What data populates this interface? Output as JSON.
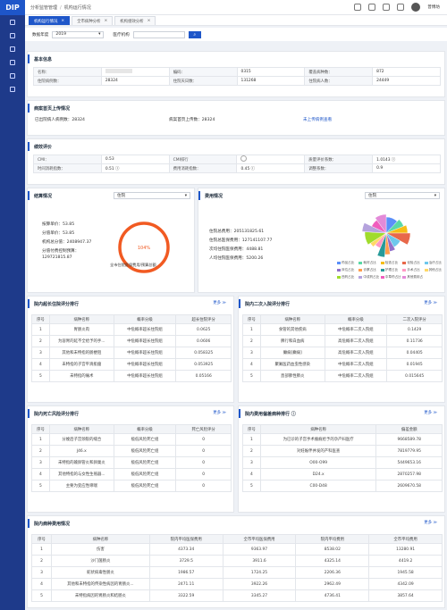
{
  "header": {
    "logo": "DIP",
    "crumbs": [
      "分析监管管理",
      "机构运行情况"
    ],
    "username": "普博坊"
  },
  "tabs": [
    {
      "label": "机构运行情况",
      "active": true
    },
    {
      "label": "全市病种分析",
      "active": false
    },
    {
      "label": "机构绩效分析",
      "active": false
    }
  ],
  "filter": {
    "year_label": "数据年度",
    "year_value": "2019",
    "org_label": "医疗机构",
    "search_icon": "search-icon"
  },
  "basic": {
    "title": "基本信息",
    "rows": [
      [
        "名称：",
        "",
        "编码：",
        "0315",
        "覆盖病种数：",
        "872"
      ],
      [
        "住院病例数：",
        "28324",
        "住院天日数：",
        "131268",
        "住院病人数：",
        "24449"
      ]
    ]
  },
  "upload": {
    "title": "病案首页上传情况",
    "items": [
      "已出院病人病例数：28324",
      "病案首页上传数：28324"
    ],
    "link": "未上传病例查看"
  },
  "perf": {
    "title": "绩效评价",
    "rows": [
      [
        "CMI：",
        "0.53",
        "CMI排行",
        "",
        "质量评价系数：",
        "1.0143"
      ],
      [
        "时间消耗指数：",
        "0.51",
        "费用消耗指数：",
        "0.45",
        "调整系数：",
        "0.9"
      ]
    ]
  },
  "settle": {
    "title": "结算情况",
    "select": "住院",
    "lines": [
      "按算单价：53.85",
      "分值单价：53.85",
      "机构总分值：2408947.37",
      "分值付费控制预算：",
      "129721815.87"
    ],
    "gauge_label": "104%",
    "gauge_value": 1.04,
    "gauge_caption": "全市住院医保费用/预算总额"
  },
  "cost": {
    "title": "费用情况",
    "select": "住院",
    "lines": [
      "住院总费用：205131825.61",
      "住院总医保费用：127141107.77",
      "次均住院医保费用：4488.81",
      "人均住院医保费用：5200.26"
    ],
    "legend": [
      {
        "name": "药品占比",
        "color": "#5b8ff9"
      },
      {
        "name": "耗材占比",
        "color": "#5ad8a6"
      },
      {
        "name": "检查占比",
        "color": "#f6bd16"
      },
      {
        "name": "化验占比",
        "color": "#e8684a"
      },
      {
        "name": "治疗占比",
        "color": "#6dc8ec"
      },
      {
        "name": "床位占比",
        "color": "#9270ca"
      },
      {
        "name": "诊察占比",
        "color": "#ff9d4d"
      },
      {
        "name": "护理占比",
        "color": "#269a99"
      },
      {
        "name": "手术占比",
        "color": "#ff99c3"
      },
      {
        "name": "其他占比",
        "color": "#ffd866"
      },
      {
        "name": "西药占比",
        "color": "#a0dc2c"
      },
      {
        "name": "中成药占比",
        "color": "#b5a3dd"
      },
      {
        "name": "中草药占比",
        "color": "#f05dbd"
      },
      {
        "name": "其他费用占比",
        "color": "#e38ad8"
      }
    ]
  },
  "chart_data": {
    "type": "pie",
    "labels": [
      "药品占比",
      "耗材占比",
      "检查占比",
      "化验占比",
      "治疗占比",
      "床位占比",
      "诊察占比",
      "护理占比",
      "手术占比",
      "其他占比",
      "西药占比",
      "中成药占比",
      "中草药占比",
      "其他费用占比"
    ],
    "values": [
      12,
      7,
      6,
      8,
      9,
      5,
      4,
      5,
      6,
      4,
      10,
      6,
      8,
      10
    ],
    "colors": [
      "#5b8ff9",
      "#5ad8a6",
      "#f6bd16",
      "#e8684a",
      "#6dc8ec",
      "#9270ca",
      "#ff9d4d",
      "#269a99",
      "#ff99c3",
      "#ffd866",
      "#a0dc2c",
      "#b5a3dd",
      "#f05dbd",
      "#e38ad8"
    ]
  },
  "more_label": "更多 ≫",
  "t1": {
    "title": "院内超长住院评分排行",
    "headers": [
      "序号",
      "病种名称",
      "概率分级",
      "超长住院评分"
    ],
    "rows": [
      [
        "1",
        "胃肠炎肉",
        "中危概率超长住院组",
        "0.0625"
      ],
      [
        "2",
        "为容胃的延不全给予的手...",
        "中危概率超长住院组",
        "0.0606"
      ],
      [
        "3",
        "其他和未特指的肠梗阻",
        "中危概率超长住院组",
        "0.058325"
      ],
      [
        "4",
        "未特指的子宫平滑肌瘤",
        "中危概率超长住院组",
        "0.053925"
      ],
      [
        "5",
        "未特指的痛术",
        "中危概率超长住院组",
        "0.05166"
      ]
    ]
  },
  "t2": {
    "title": "院内二次入院评分排行",
    "headers": [
      "序号",
      "病种名称",
      "概率分级",
      "二次入院评分"
    ],
    "rows": [
      [
        "1",
        "食管的其他疾病",
        "中危概率二次入院组",
        "0.1429"
      ],
      [
        "2",
        "脾行和白血病",
        "高危概率二次入院组",
        "0.11736"
      ],
      [
        "3",
        "癫痫[癫痫]",
        "高危概率二次入院组",
        "0.04405"
      ],
      [
        "4",
        "聚氟医药血虫性感染",
        "中危概率二次入院组",
        "0.01945"
      ],
      [
        "5",
        "直部肺性肺炎",
        "中危概率二次入院组",
        "0.015645"
      ]
    ]
  },
  "t3": {
    "title": "院内死亡风险评分排行",
    "headers": [
      "序号",
      "病种名称",
      "概率分级",
      "死亡风险评分"
    ],
    "rows": [
      [
        "1",
        "分娩后子宫颈裂的缝合",
        "极低风险死亡组",
        "0"
      ],
      [
        "2",
        "J46.x",
        "极低风险死亡组",
        "0"
      ],
      [
        "3",
        "未特指的输卵管炎和卵巢炎",
        "极低风险死亡组",
        "0"
      ],
      [
        "4",
        "其他特指的与女性生殖器...",
        "极低风险死亡组",
        "0"
      ],
      [
        "5",
        "主要为变应性哮喘",
        "极低风险死亡组",
        "0"
      ]
    ]
  },
  "t4": {
    "title": "院内费用偏差病种排行",
    "headers": [
      "序号",
      "病种名称",
      "偏差金额"
    ],
    "rows": [
      [
        "1",
        "为已诊的子宫手术瘢痕给予的孕产妇医疗",
        "9668589.78"
      ],
      [
        "2",
        "对妊娠伴并发的产科医查",
        "7819779.95"
      ],
      [
        "3",
        "O00-O99",
        "5449653.16"
      ],
      [
        "4",
        "D24.x",
        "2870257.98"
      ],
      [
        "5",
        "C00-D48",
        "2609670.58"
      ]
    ]
  },
  "t5": {
    "title": "院内病种费用情况",
    "headers": [
      "序号",
      "病种名称",
      "院内平均医保费用",
      "全市平均医保费用",
      "院内平均费用",
      "全市平均费用"
    ],
    "rows": [
      [
        "1",
        "伤害",
        "4373.34",
        "9363.97",
        "8538.02",
        "13280.91"
      ],
      [
        "2",
        "沙门菌肠炎",
        "3729.5",
        "3911.6",
        "4325.14",
        "4419.2"
      ],
      [
        "3",
        "蛇状病毒性肠炎",
        "1986.57",
        "1724.25",
        "2206.36",
        "1945.58"
      ],
      [
        "4",
        "其他和未特指的传染性病因的胃肠炎...",
        "2471.11",
        "3922.26",
        "2962.49",
        "4342.09"
      ],
      [
        "5",
        "未特指病因的胃肠炎和结肠炎",
        "3322.59",
        "3345.27",
        "4736.41",
        "3857.64"
      ]
    ]
  }
}
